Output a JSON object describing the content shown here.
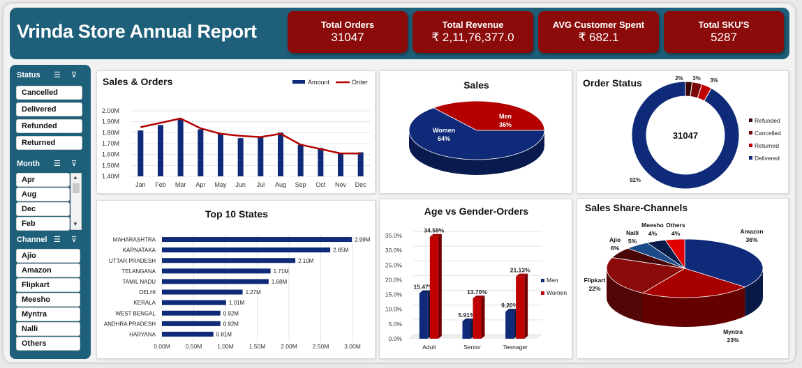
{
  "header": {
    "title": "Vrinda Store Annual Report"
  },
  "kpis": [
    {
      "label": "Total Orders",
      "value": "31047"
    },
    {
      "label": "Total Revenue",
      "value": "₹ 2,11,76,377.0"
    },
    {
      "label": "AVG Customer Spent",
      "value": "₹ 682.1"
    },
    {
      "label": "Total SKU'S",
      "value": "5287"
    }
  ],
  "slicers": {
    "status": {
      "title": "Status",
      "items": [
        "Cancelled",
        "Delivered",
        "Refunded",
        "Returned"
      ]
    },
    "month": {
      "title": "Month",
      "items": [
        "Apr",
        "Aug",
        "Dec",
        "Feb"
      ]
    },
    "channel": {
      "title": "Channel",
      "items": [
        "Ajio",
        "Amazon",
        "Flipkart",
        "Meesho",
        "Myntra",
        "Nalli",
        "Others"
      ]
    }
  },
  "colors": {
    "navy": "#0e2a78",
    "red": "#b30000",
    "darkred": "#8b0a0a",
    "teal": "#1e5f7a"
  },
  "chart_data": [
    {
      "id": "sales_orders",
      "type": "bar",
      "title": "Sales & Orders",
      "categories": [
        "Jan",
        "Feb",
        "Mar",
        "Apr",
        "May",
        "Jun",
        "Jul",
        "Aug",
        "Sep",
        "Oct",
        "Nov",
        "Dec"
      ],
      "series": [
        {
          "name": "Amount",
          "type": "bar",
          "values": [
            1.82,
            1.87,
            1.92,
            1.83,
            1.79,
            1.75,
            1.76,
            1.8,
            1.69,
            1.66,
            1.61,
            1.62
          ]
        },
        {
          "name": "Order",
          "type": "line",
          "values": [
            1.85,
            1.89,
            1.93,
            1.84,
            1.79,
            1.77,
            1.76,
            1.79,
            1.69,
            1.65,
            1.61,
            1.61
          ]
        }
      ],
      "yticks": [
        "1.40M",
        "1.50M",
        "1.60M",
        "1.70M",
        "1.80M",
        "1.90M",
        "2.00M"
      ],
      "ylim": [
        1.4,
        2.0
      ]
    },
    {
      "id": "sales_gender",
      "type": "pie",
      "title": "Sales",
      "labels": [
        "Women",
        "Men"
      ],
      "values": [
        64,
        36
      ],
      "value_labels": [
        "64%",
        "36%"
      ]
    },
    {
      "id": "order_status",
      "type": "pie",
      "title": "Order Status",
      "center_label": "31047",
      "labels": [
        "Refunded",
        "Cancelled",
        "Returned",
        "Delivered"
      ],
      "values": [
        2,
        3,
        3,
        92
      ],
      "value_labels": [
        "2%",
        "3%",
        "3%",
        "92%"
      ]
    },
    {
      "id": "top_states",
      "type": "bar",
      "title": "Top 10 States",
      "categories": [
        "MAHARASHTRA",
        "KARNATAKA",
        "UTTAR PRADESH",
        "TELANGANA",
        "TAMIL NADU",
        "DELHI",
        "KERALA",
        "WEST BENGAL",
        "ANDHRA PRADESH",
        "HARYANA"
      ],
      "values": [
        2.99,
        2.65,
        2.1,
        1.71,
        1.68,
        1.27,
        1.01,
        0.92,
        0.92,
        0.81
      ],
      "value_labels": [
        "2.99M",
        "2.65M",
        "2.10M",
        "1.71M",
        "1.68M",
        "1.27M",
        "1.01M",
        "0.92M",
        "0.92M",
        "0.81M"
      ],
      "xticks": [
        "0.00M",
        "0.50M",
        "1.00M",
        "1.50M",
        "2.00M",
        "2.50M",
        "3.00M"
      ],
      "xlim": [
        0,
        3.0
      ]
    },
    {
      "id": "age_gender",
      "type": "bar",
      "title": "Age vs Gender-Orders",
      "categories": [
        "Adult",
        "Senior",
        "Teenager"
      ],
      "series": [
        {
          "name": "Men",
          "values": [
            15.47,
            5.91,
            9.2
          ],
          "labels": [
            "15.47%",
            "5.91%",
            "9.20%"
          ]
        },
        {
          "name": "Women",
          "values": [
            34.59,
            13.7,
            21.13
          ],
          "labels": [
            "34.59%",
            "13.70%",
            "21.13%"
          ]
        }
      ],
      "yticks": [
        "0.0%",
        "5.0%",
        "10.0%",
        "15.0%",
        "20.0%",
        "25.0%",
        "30.0%",
        "35.0%"
      ],
      "ylim": [
        0,
        35
      ]
    },
    {
      "id": "channels",
      "type": "pie",
      "title": "Sales Share-Channels",
      "labels": [
        "Amazon",
        "Myntra",
        "Flipkart",
        "Ajio",
        "Nalli",
        "Meesho",
        "Others"
      ],
      "values": [
        36,
        23,
        22,
        6,
        5,
        4,
        4
      ],
      "value_labels": [
        "36%",
        "23%",
        "22%",
        "6%",
        "5%",
        "4%",
        "4%"
      ]
    }
  ]
}
